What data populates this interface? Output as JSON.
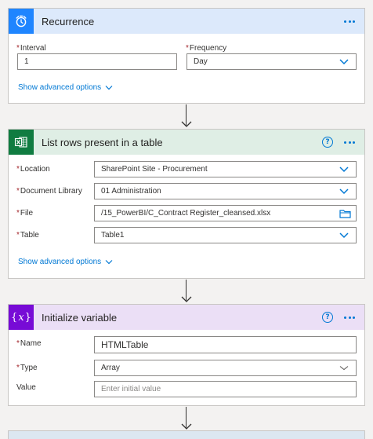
{
  "recurrence": {
    "title": "Recurrence",
    "icon": "alarm-clock-icon",
    "header_color": "#dce9fb",
    "icon_color": "#1f85ff",
    "interval_label": "Interval",
    "interval_value": "1",
    "frequency_label": "Frequency",
    "frequency_value": "Day",
    "advanced_label": "Show advanced options"
  },
  "list_rows": {
    "title": "List rows present in a table",
    "icon": "excel-icon",
    "header_color": "#dfeee5",
    "icon_color": "#107c41",
    "location_label": "Location",
    "location_value": "SharePoint Site - Procurement",
    "library_label": "Document Library",
    "library_value": "01 Administration",
    "file_label": "File",
    "file_value": "/15_PowerBI/C_Contract Register_cleansed.xlsx",
    "table_label": "Table",
    "table_value": "Table1",
    "advanced_label": "Show advanced options"
  },
  "init_var": {
    "title": "Initialize variable",
    "icon": "variable-icon",
    "header_color": "#ebdff6",
    "icon_color": "#770bd6",
    "name_label": "Name",
    "name_value": "HTMLTable",
    "type_label": "Type",
    "type_value": "Array",
    "value_label": "Value",
    "value_placeholder": "Enter initial value"
  }
}
